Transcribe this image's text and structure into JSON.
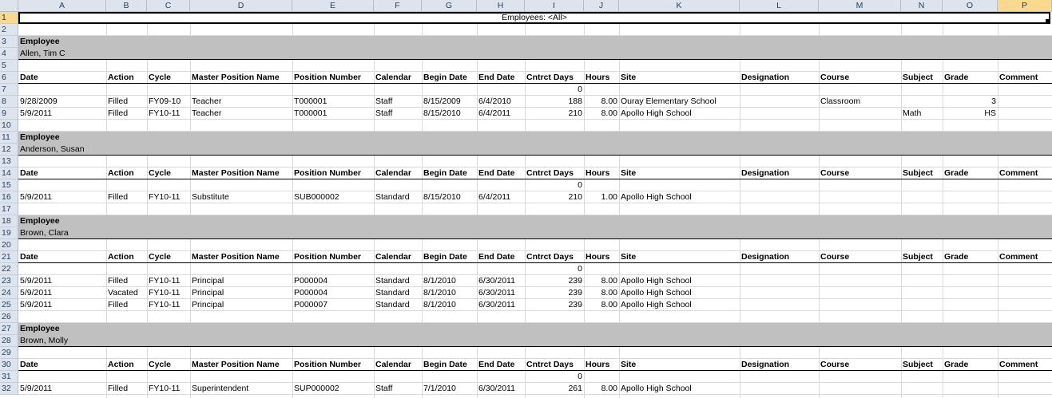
{
  "columns": [
    "A",
    "B",
    "C",
    "D",
    "E",
    "F",
    "G",
    "H",
    "I",
    "J",
    "K",
    "L",
    "M",
    "N",
    "O",
    "P"
  ],
  "title": "Employees: <All>",
  "labels": {
    "employee": "Employee",
    "headers": [
      "Date",
      "Action",
      "Cycle",
      "Master Position Name",
      "Position Number",
      "Calendar",
      "Begin Date",
      "End Date",
      "Cntrct Days",
      "Hours",
      "Site",
      "Designation",
      "Course",
      "Subject",
      "Grade",
      "Comment"
    ]
  },
  "rows": [
    {
      "n": "1",
      "kind": "title"
    },
    {
      "n": "2",
      "kind": "blank"
    },
    {
      "n": "3",
      "kind": "emp",
      "emp": 0
    },
    {
      "n": "4",
      "kind": "empname",
      "emp": 0
    },
    {
      "n": "5",
      "kind": "blank"
    },
    {
      "n": "6",
      "kind": "hdr"
    },
    {
      "n": "7",
      "kind": "zero",
      "group": 0
    },
    {
      "n": "8",
      "kind": "data",
      "rec": 0
    },
    {
      "n": "9",
      "kind": "data",
      "rec": 1
    },
    {
      "n": "10",
      "kind": "blank"
    },
    {
      "n": "11",
      "kind": "emp",
      "emp": 1
    },
    {
      "n": "12",
      "kind": "empname",
      "emp": 1
    },
    {
      "n": "13",
      "kind": "blank"
    },
    {
      "n": "14",
      "kind": "hdr"
    },
    {
      "n": "15",
      "kind": "zero",
      "group": 1
    },
    {
      "n": "16",
      "kind": "data",
      "rec": 2
    },
    {
      "n": "17",
      "kind": "blank"
    },
    {
      "n": "18",
      "kind": "emp",
      "emp": 2
    },
    {
      "n": "19",
      "kind": "empname",
      "emp": 2
    },
    {
      "n": "20",
      "kind": "blank"
    },
    {
      "n": "21",
      "kind": "hdr"
    },
    {
      "n": "22",
      "kind": "zero",
      "group": 2
    },
    {
      "n": "23",
      "kind": "data",
      "rec": 3
    },
    {
      "n": "24",
      "kind": "data",
      "rec": 4
    },
    {
      "n": "25",
      "kind": "data",
      "rec": 5
    },
    {
      "n": "26",
      "kind": "blank"
    },
    {
      "n": "27",
      "kind": "emp",
      "emp": 3
    },
    {
      "n": "28",
      "kind": "empname",
      "emp": 3
    },
    {
      "n": "29",
      "kind": "blank"
    },
    {
      "n": "30",
      "kind": "hdr"
    },
    {
      "n": "31",
      "kind": "zero",
      "group": 3
    },
    {
      "n": "32",
      "kind": "data",
      "rec": 6
    }
  ],
  "employees": [
    "Allen, Tim C",
    "Anderson, Susan",
    "Brown, Clara",
    "Brown, Molly"
  ],
  "zero_value": "0",
  "records": [
    [
      "9/28/2009",
      "Filled",
      "FY09-10",
      "Teacher",
      "T000001",
      "Staff",
      "8/15/2009",
      "6/4/2010",
      "188",
      "8.00",
      "Ouray Elementary School",
      "",
      "Classroom",
      "",
      "3",
      ""
    ],
    [
      "5/9/2011",
      "Filled",
      "FY10-11",
      "Teacher",
      "T000001",
      "Staff",
      "8/15/2010",
      "6/4/2011",
      "210",
      "8.00",
      "Apollo High School",
      "",
      "",
      "Math",
      "HS",
      ""
    ],
    [
      "5/9/2011",
      "Filled",
      "FY10-11",
      "Substitute",
      "SUB000002",
      "Standard",
      "8/15/2010",
      "6/4/2011",
      "210",
      "1.00",
      "Apollo High School",
      "",
      "",
      "",
      "",
      ""
    ],
    [
      "5/9/2011",
      "Filled",
      "FY10-11",
      "Principal",
      "P000004",
      "Standard",
      "8/1/2010",
      "6/30/2011",
      "239",
      "8.00",
      "Apollo High School",
      "",
      "",
      "",
      "",
      ""
    ],
    [
      "5/9/2011",
      "Vacated",
      "FY10-11",
      "Principal",
      "P000004",
      "Standard",
      "8/1/2010",
      "6/30/2011",
      "239",
      "8.00",
      "Apollo High School",
      "",
      "",
      "",
      "",
      ""
    ],
    [
      "5/9/2011",
      "Filled",
      "FY10-11",
      "Principal",
      "P000007",
      "Standard",
      "8/1/2010",
      "6/30/2011",
      "239",
      "8.00",
      "Apollo High School",
      "",
      "",
      "",
      "",
      ""
    ],
    [
      "5/9/2011",
      "Filled",
      "FY10-11",
      "Superintendent",
      "SUP000002",
      "Staff",
      "7/1/2010",
      "6/30/2011",
      "261",
      "8.00",
      "Apollo High School",
      "",
      "",
      "",
      "",
      ""
    ]
  ]
}
